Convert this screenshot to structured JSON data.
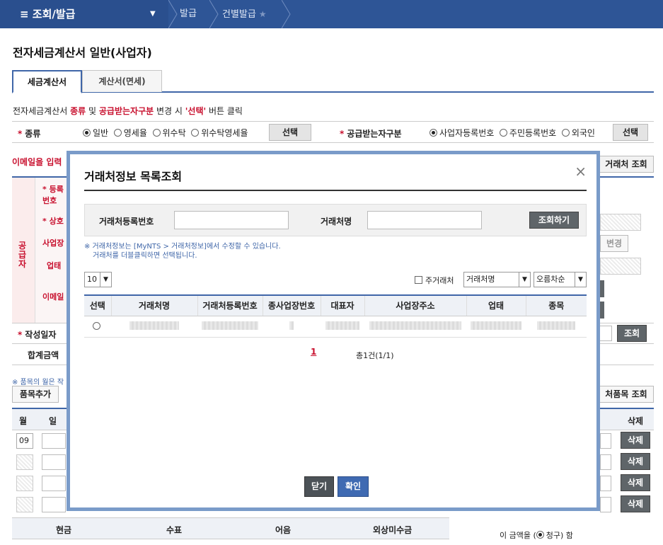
{
  "nav": {
    "menu_label": "≡  조회/발급",
    "crumbs": [
      "발급",
      "건별발급"
    ]
  },
  "page": {
    "title": "전자세금계산서 일반(사업자)",
    "tabs": [
      "세금계산서",
      "계산서(면세)"
    ],
    "notice": {
      "p1": "전자세금계산서 ",
      "p2": "종류",
      "p3": " 및 ",
      "p4": "공급받는자구분",
      "p5": " 변경 시 ",
      "p6": "'선택'",
      "p7": " 버튼 클릭"
    }
  },
  "form": {
    "type_label": "종류",
    "type_options": [
      "일반",
      "영세율",
      "위수탁",
      "위수탁영세율"
    ],
    "select_btn": "선택",
    "receiver_label": "공급받는자구분",
    "receiver_options": [
      "사업자등록번호",
      "주민등록번호",
      "외국인"
    ],
    "email_prompt": "이메일을 입력",
    "partner_lookup_btn": "거래처 조회",
    "supplier_vertical": "공급자",
    "side_labels": [
      "등록번호",
      "상호",
      "사업장",
      "업태",
      "이메일"
    ],
    "change_btn": "변경",
    "write_date_label": "작성일자",
    "lookup_btn": "조회",
    "total_label": "합계금액",
    "item_notice": "※ 품목의 월은 작",
    "add_item_btn": "품목추가",
    "partner_item_btn": "처품목 조회",
    "col_month": "월",
    "col_day": "일",
    "col_delete": "삭제",
    "row1_month": "09",
    "delete_btn": "삭제",
    "payment_headers": [
      "현금",
      "수표",
      "어음",
      "외상미수금"
    ],
    "claim_text": "이 금액을 (",
    "claim_option": "청구",
    "claim_suffix": ") 함"
  },
  "modal": {
    "title": "거래처정보 목록조회",
    "close_icon": "×",
    "search_reg_label": "거래처등록번호",
    "search_name_label": "거래처명",
    "search_reg_value": "",
    "search_name_value": "",
    "search_btn": "조회하기",
    "hint_line1": "※ 거래처정보는 [MyNTS > 거래처정보]에서 수정할 수 있습니다.",
    "hint_line2": "거래처를 더블클릭하면 선택됩니다.",
    "page_size": "10",
    "main_partner_label": "주거래처",
    "sort_field": "거래처명",
    "sort_order": "오름차순",
    "columns": [
      "선택",
      "거래처명",
      "거래처등록번호",
      "종사업장번호",
      "대표자",
      "사업장주소",
      "업태",
      "종목"
    ],
    "page_num": "1",
    "total_count": "총1건(1/1)",
    "close_btn": "닫기",
    "confirm_btn": "확인"
  }
}
